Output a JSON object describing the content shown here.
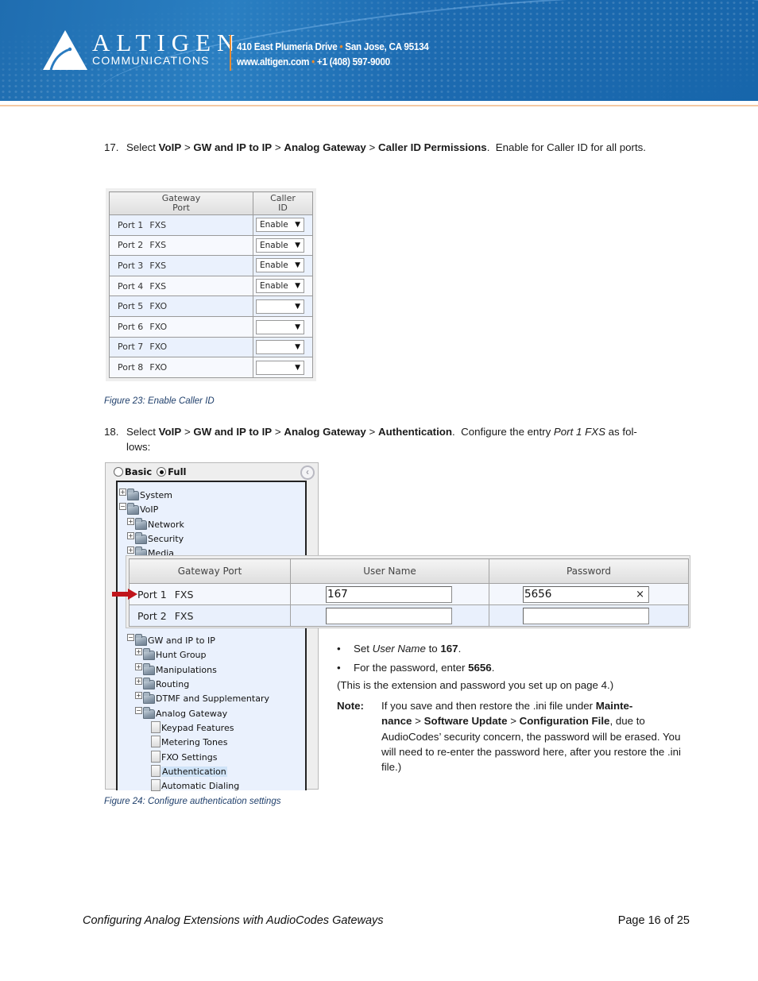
{
  "header": {
    "brand_name": "ALTIGEN",
    "brand_sub": "COMMUNICATIONS",
    "address_street": "410 East Plumeria Drive",
    "address_city": "San Jose, CA 95134",
    "website": "www.altigen.com",
    "phone": "+1 (408) 597-9000",
    "separator": "•",
    "accent_color": "#e98b2f",
    "banner_color": "#1f6db0"
  },
  "step17": {
    "number": "17.",
    "select_word": "Select",
    "path": [
      "VoIP",
      "GW and IP to IP",
      "Analog Gateway",
      "Caller ID Permissions"
    ],
    "path_separator": ">",
    "trailing": ".  Enable for Caller ID for all ports."
  },
  "caller_id_table": {
    "headers": [
      "Gateway\nPort",
      "Caller\nID"
    ],
    "header_port_line1": "Gateway",
    "header_port_line2": "Port",
    "header_cid_line1": "Caller",
    "header_cid_line2": "ID",
    "rows": [
      {
        "port": "Port 1",
        "type": "FXS",
        "caller_id": "Enable"
      },
      {
        "port": "Port 2",
        "type": "FXS",
        "caller_id": "Enable"
      },
      {
        "port": "Port 3",
        "type": "FXS",
        "caller_id": "Enable"
      },
      {
        "port": "Port 4",
        "type": "FXS",
        "caller_id": "Enable"
      },
      {
        "port": "Port 5",
        "type": "FXO",
        "caller_id": ""
      },
      {
        "port": "Port 6",
        "type": "FXO",
        "caller_id": ""
      },
      {
        "port": "Port 7",
        "type": "FXO",
        "caller_id": ""
      },
      {
        "port": "Port 8",
        "type": "FXO",
        "caller_id": ""
      }
    ],
    "dropdown_arrow": "▼"
  },
  "figure23_caption": "Figure 23: Enable Caller ID",
  "step18": {
    "number": "18.",
    "select_word": "Select",
    "path": [
      "VoIP",
      "GW and IP to IP",
      "Analog Gateway",
      "Authentication"
    ],
    "path_separator": ">",
    "middle": ".  Configure the entry ",
    "entry": "Port 1 FXS",
    "trailing_line1": " as fol-",
    "trailing_line2": "lows:"
  },
  "nav_panel": {
    "mode_basic": "Basic",
    "mode_full": "Full",
    "mode_selected": "Full",
    "collapse_icon": "‹",
    "tree": [
      {
        "label": "System",
        "expander": "+",
        "kind": "folder"
      },
      {
        "label": "VoIP",
        "expander": "−",
        "kind": "folder"
      },
      {
        "label": "Network",
        "expander": "+",
        "kind": "folder"
      },
      {
        "label": "Security",
        "expander": "+",
        "kind": "folder"
      },
      {
        "label": "Media",
        "expander": "+",
        "kind": "folder"
      },
      {
        "label": "GW and IP to IP",
        "expander": "−",
        "kind": "folder"
      },
      {
        "label": "Hunt Group",
        "expander": "+",
        "kind": "folder"
      },
      {
        "label": "Manipulations",
        "expander": "+",
        "kind": "folder"
      },
      {
        "label": "Routing",
        "expander": "+",
        "kind": "folder"
      },
      {
        "label": "DTMF and Supplementary",
        "expander": "+",
        "kind": "folder"
      },
      {
        "label": "Analog Gateway",
        "expander": "−",
        "kind": "folder"
      },
      {
        "label": "Keypad Features",
        "kind": "page"
      },
      {
        "label": "Metering Tones",
        "kind": "page"
      },
      {
        "label": "FXO Settings",
        "kind": "page"
      },
      {
        "label": "Authentication",
        "kind": "page",
        "selected": true
      },
      {
        "label": "Automatic Dialing",
        "kind": "page"
      }
    ]
  },
  "auth_table": {
    "headers": [
      "Gateway Port",
      "User Name",
      "Password"
    ],
    "rows": [
      {
        "port": "Port 1",
        "type": "FXS",
        "user_name": "167",
        "password": "5656",
        "clear_icon": "×"
      },
      {
        "port": "Port 2",
        "type": "FXS",
        "user_name": "",
        "password": ""
      }
    ]
  },
  "instructions": {
    "bullet1_pre": "Set ",
    "bullet1_em": "User Name",
    "bullet1_mid": " to ",
    "bullet1_val": "167",
    "bullet1_end": ".",
    "bullet2_pre": "For the password, enter ",
    "bullet2_val": "5656",
    "bullet2_end": ".",
    "aside": "(This is the extension and password you set up on page 4.)",
    "note_label": "Note:",
    "note_pre": "If you save and then restore the .ini file under ",
    "note_path": [
      "Mainte-nance",
      "Software Update",
      "Configuration File"
    ],
    "note_path_1a": "Mainte-",
    "note_path_1b": "nance",
    "note_sep": " > ",
    "note_post": ", due to AudioCodes’ security concern, the password will be erased. You will need to re-enter the password here, after you restore the .ini file.)"
  },
  "figure24_caption": "Figure 24: Configure authentication settings",
  "footer": {
    "title": "Configuring Analog Extensions with AudioCodes Gateways",
    "page_label": "Page 16 of 25",
    "page_current": 16,
    "page_total": 25
  }
}
